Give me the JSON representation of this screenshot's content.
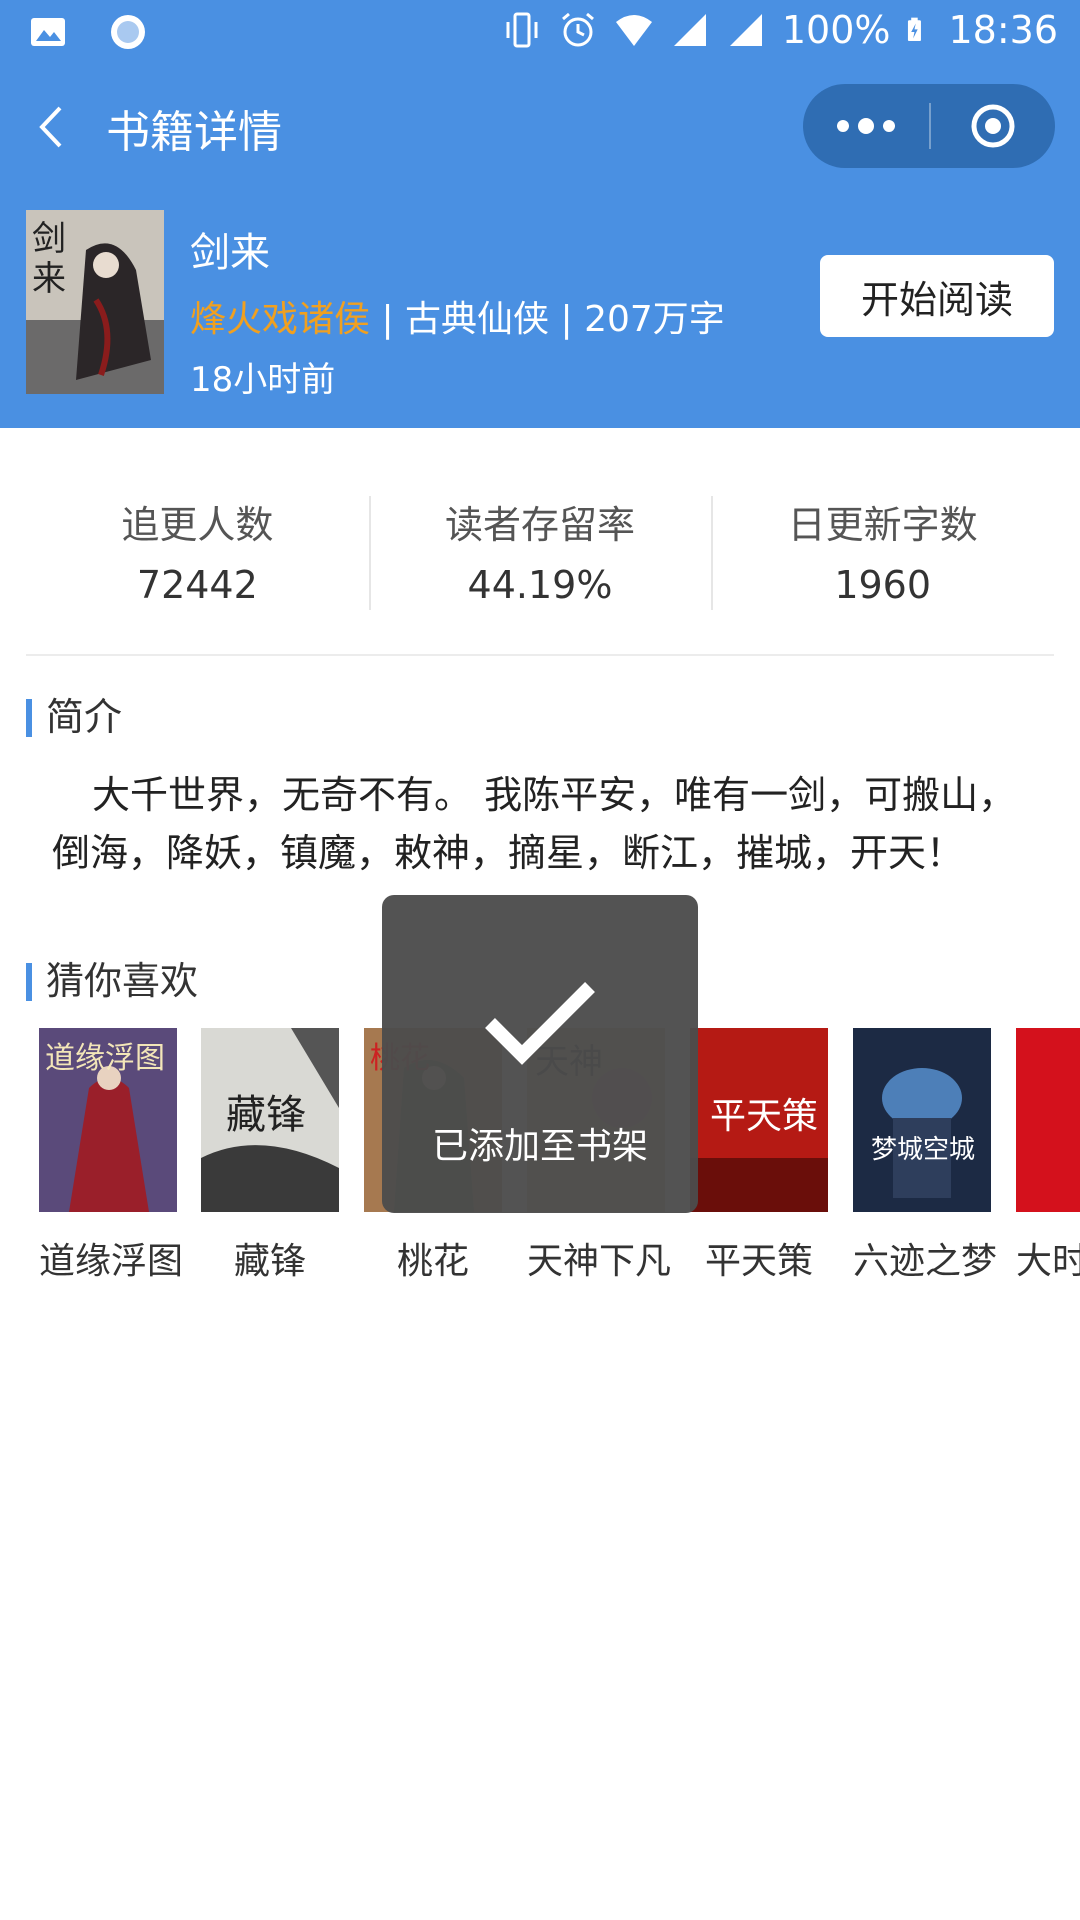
{
  "status_bar": {
    "battery": "100%",
    "time": "18:36",
    "icons": [
      "image-icon",
      "record-icon",
      "vibrate-icon",
      "alarm-icon",
      "wifi-icon",
      "signal-icon",
      "signal-icon",
      "battery-charging-icon"
    ]
  },
  "nav": {
    "title": "书籍详情",
    "back_icon": "chevron-left-icon",
    "more_icon": "more-icon",
    "close_icon": "target-icon"
  },
  "book": {
    "title": "剑来",
    "author": "烽火戏诸侯",
    "separator": " | ",
    "genre": "古典仙侠",
    "word_count": "207万字",
    "updated": "18小时前",
    "start_button": "开始阅读"
  },
  "stats": [
    {
      "label": "追更人数",
      "value": "72442"
    },
    {
      "label": "读者存留率",
      "value": "44.19%"
    },
    {
      "label": "日更新字数",
      "value": "1960"
    }
  ],
  "intro": {
    "title": "简介",
    "text": "大千世界，无奇不有。 我陈平安，唯有一剑，可搬山，倒海，降妖，镇魔，敕神，摘星，断江，摧城，开天！"
  },
  "recommend": {
    "title": "猜你喜欢",
    "items": [
      {
        "name": "道缘浮图",
        "cover_text": "道缘浮图"
      },
      {
        "name": "藏锋",
        "cover_text": "藏锋"
      },
      {
        "name": "桃花",
        "cover_text": "桃花"
      },
      {
        "name": "天神下凡",
        "cover_text": "天神"
      },
      {
        "name": "平天策",
        "cover_text": "平天策"
      },
      {
        "name": "六迹之梦",
        "cover_text": "梦城空城"
      },
      {
        "name": "大时",
        "cover_text": ""
      }
    ]
  },
  "toast": {
    "text": "已添加至书架",
    "icon": "checkmark-icon"
  },
  "colors": {
    "primary": "#4a90e2",
    "author": "#f0a020",
    "toast_bg": "#4c4c4c"
  }
}
